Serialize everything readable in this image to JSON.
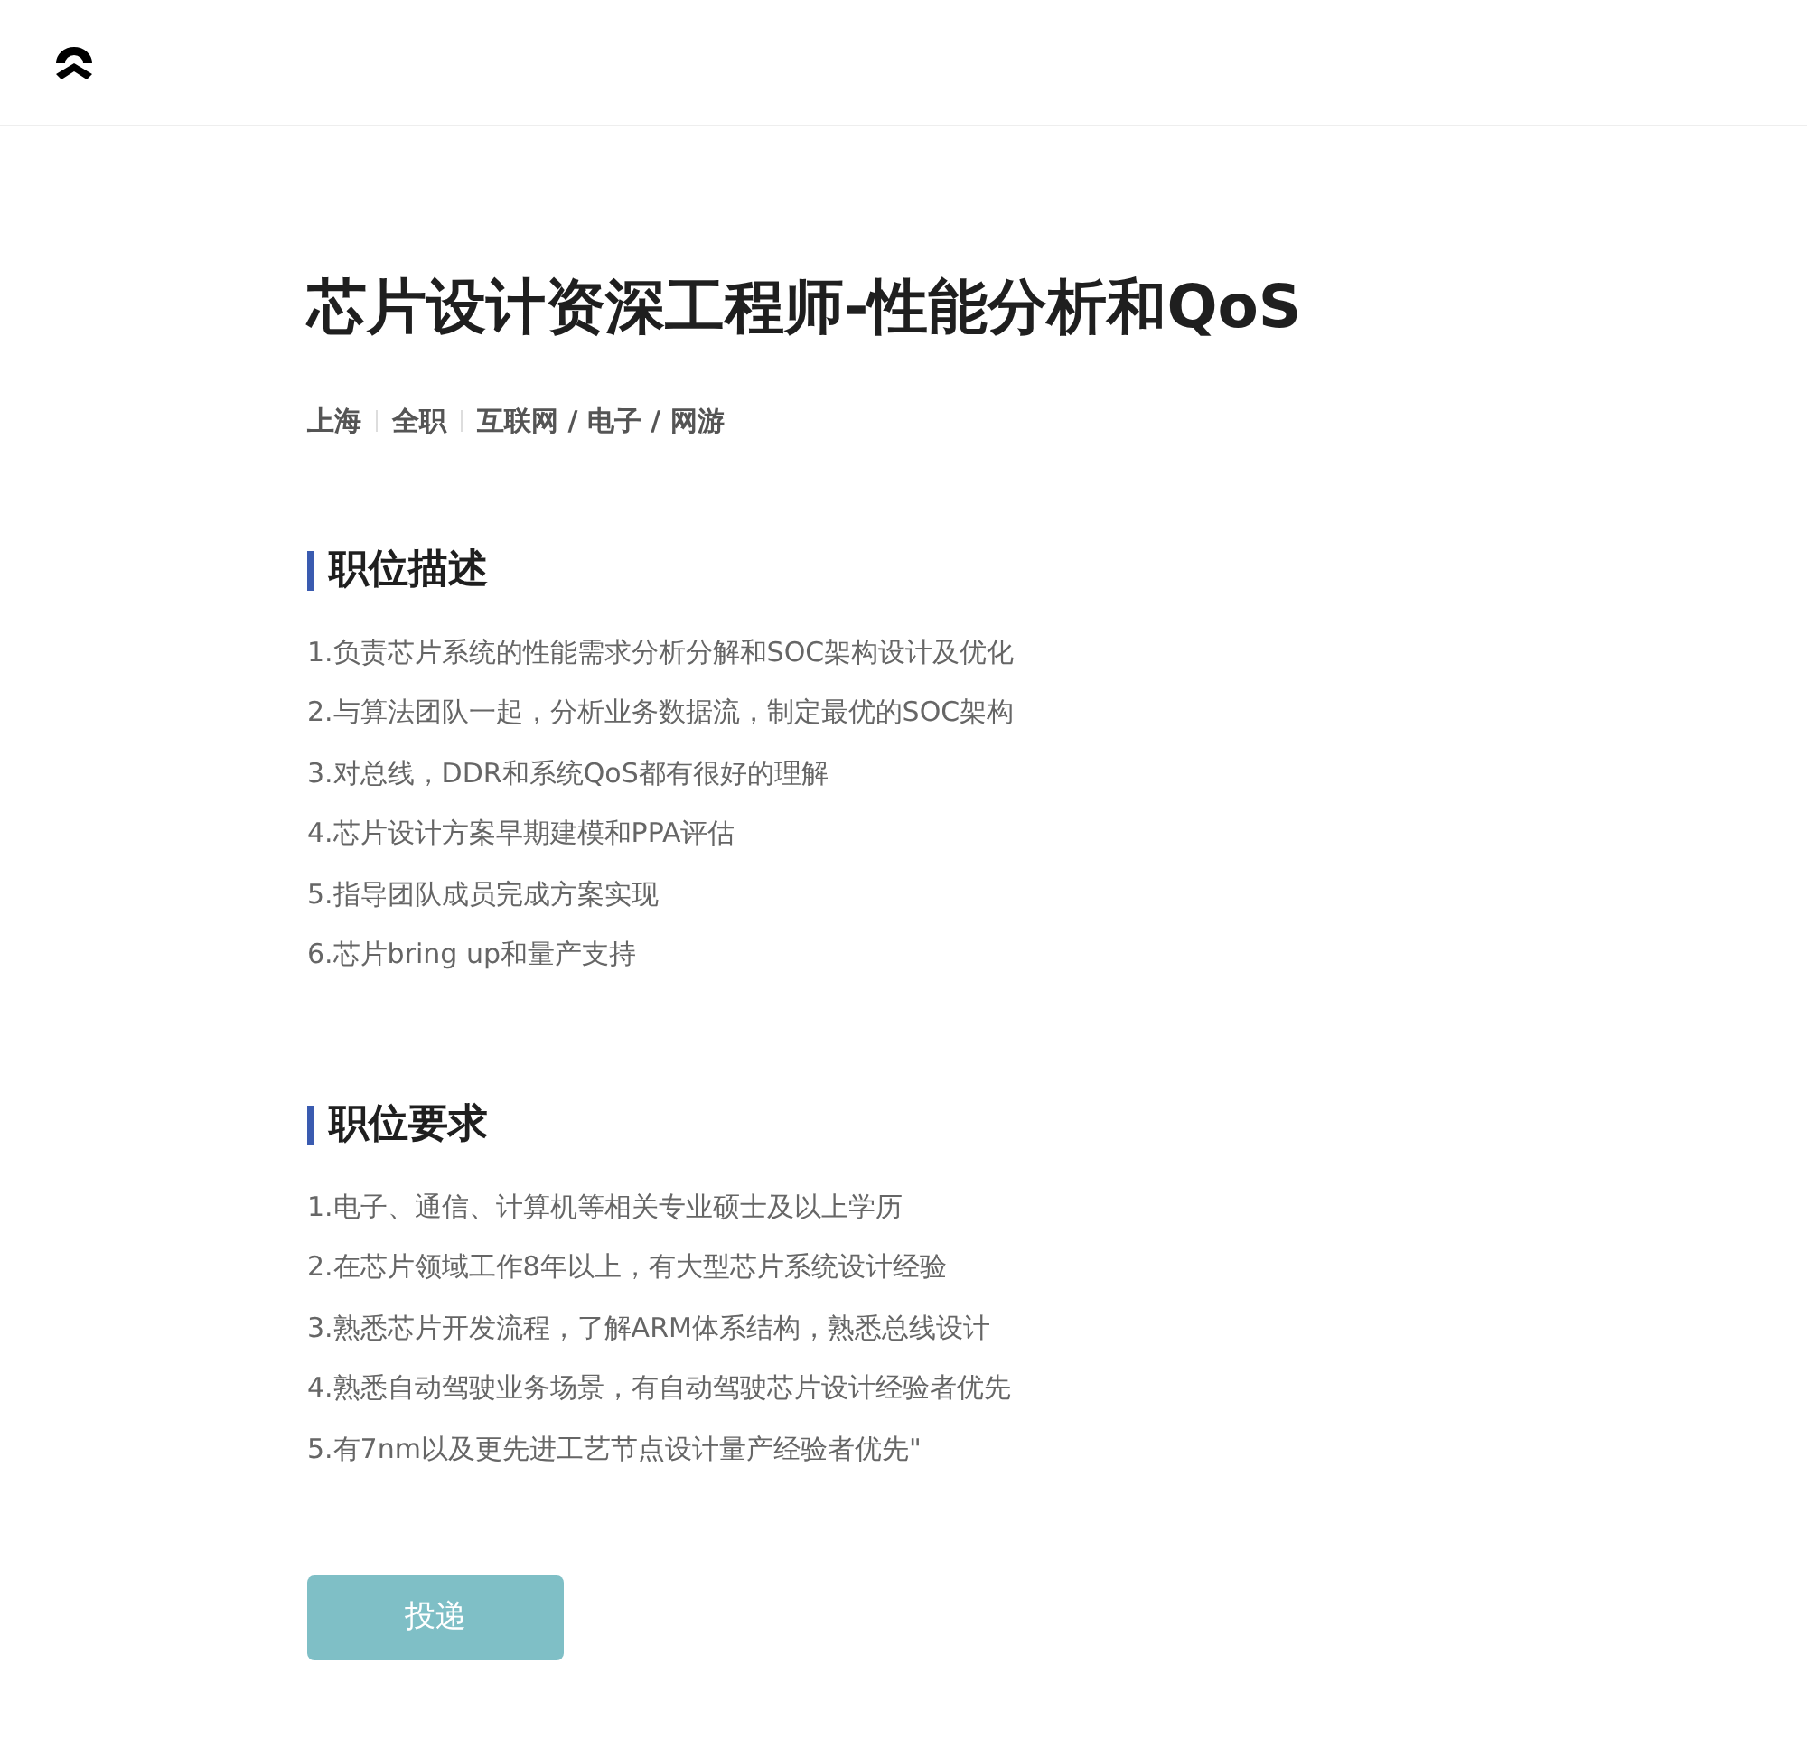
{
  "job": {
    "title": "芯片设计资深工程师-性能分析和QoS",
    "meta": [
      "上海",
      "全职",
      "互联网 / 电子 / 网游"
    ]
  },
  "sections": [
    {
      "heading": "职位描述",
      "items": [
        "1.负责芯片系统的性能需求分析分解和SOC架构设计及优化",
        "2.与算法团队一起，分析业务数据流，制定最优的SOC架构",
        "3.对总线，DDR和系统QoS都有很好的理解",
        "4.芯片设计方案早期建模和PPA评估",
        "5.指导团队成员完成方案实现",
        "6.芯片bring up和量产支持"
      ]
    },
    {
      "heading": "职位要求",
      "items": [
        "1.电子、通信、计算机等相关专业硕士及以上学历",
        "2.在芯片领域工作8年以上，有大型芯片系统设计经验",
        "3.熟悉芯片开发流程，了解ARM体系结构，熟悉总线设计",
        "4.熟悉自动驾驶业务场景，有自动驾驶芯片设计经验者优先",
        "5.有7nm以及更先进工艺节点设计量产经验者优先\""
      ]
    }
  ],
  "apply_button": {
    "label": "投递",
    "disabled": true
  }
}
